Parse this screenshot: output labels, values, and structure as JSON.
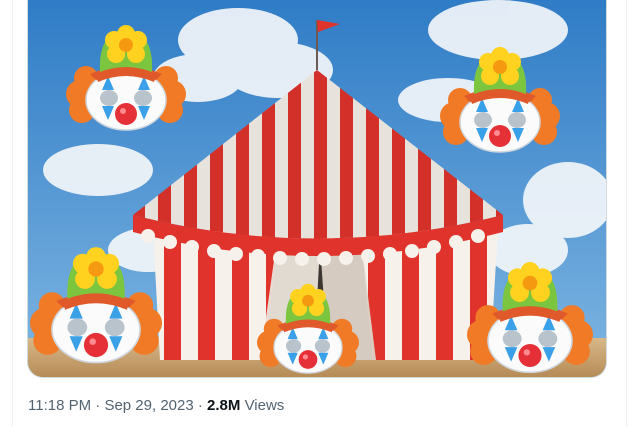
{
  "tweet": {
    "media": {
      "description_name": "circus-tent-image"
    },
    "time": "11:18 PM",
    "separator": "·",
    "date": "Sep 29, 2023",
    "separator2": "·",
    "views_count": "2.8M",
    "views_label": "Views"
  },
  "colors": {
    "sky": "#4a8fd0",
    "tent_red": "#e0332b",
    "tent_white": "#f6f1ea",
    "meta_text": "#536471",
    "views_text": "#0f1419"
  }
}
